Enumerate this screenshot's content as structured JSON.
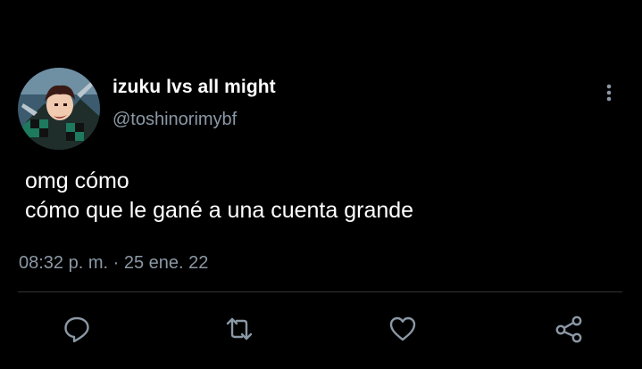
{
  "tweet": {
    "author": {
      "display_name": "izuku lvs all might",
      "handle": "@toshinorimybf",
      "avatar_icon": "avatar-image"
    },
    "text_lines": [
      "omg cómo",
      "cómo que le gané a una cuenta grande"
    ],
    "timestamp": "08:32 p. m. · 25 ene. 22"
  },
  "actions": [
    {
      "name": "reply",
      "icon": "comment-icon"
    },
    {
      "name": "retweet",
      "icon": "retweet-icon"
    },
    {
      "name": "like",
      "icon": "heart-icon"
    },
    {
      "name": "share",
      "icon": "share-icon"
    }
  ],
  "colors": {
    "background": "#000000",
    "text": "#ffffff",
    "secondary": "#8b98a5",
    "divider": "#2f3336"
  }
}
